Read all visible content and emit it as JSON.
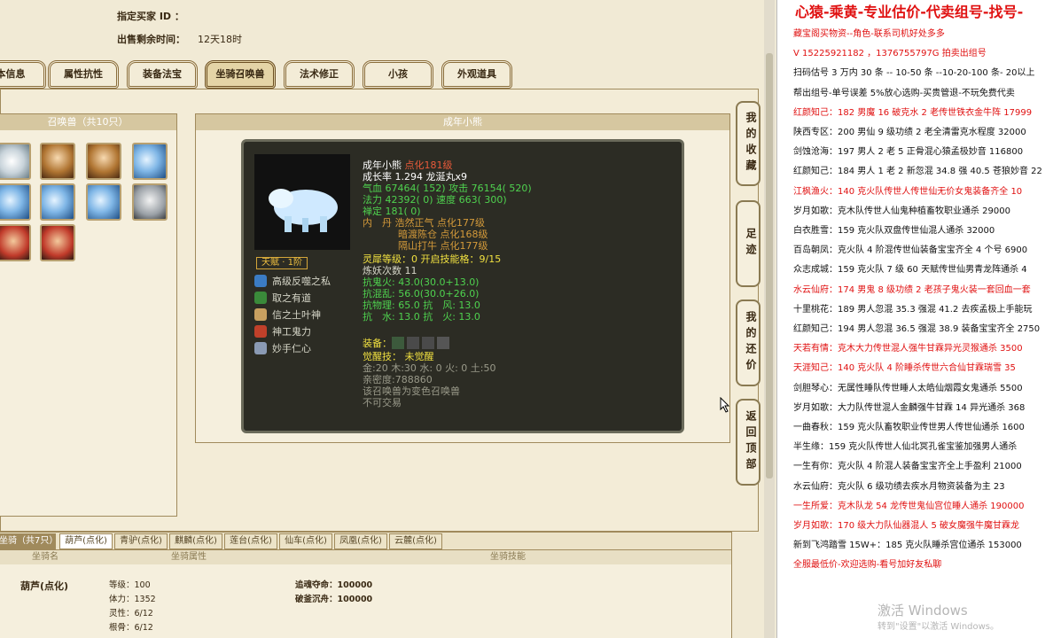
{
  "sale": {
    "buyer_label": "指定买家 ID ：",
    "remain_label": "出售剩余时间：",
    "remain_value": "12天18时"
  },
  "tabs": [
    "本信息",
    "属性抗性",
    "装备法宝",
    "坐骑召唤兽",
    "法术修正",
    "小孩",
    "外观道具"
  ],
  "pet_panel": {
    "header": "召唤兽（共10只）"
  },
  "detail_panel": {
    "header": "成年小熊"
  },
  "card": {
    "name": "成年小熊",
    "level": "点化181级",
    "growth": "成长率 1.294 龙涎丸x9",
    "hp_label": "气血",
    "hp": "67464( 152)",
    "atk_label": "攻击",
    "atk": "76154( 520)",
    "mp_label": "法力",
    "mp": "42392( 0)",
    "spd_label": "速度",
    "spd": "663( 300)",
    "zen": "禅定 181( 0)",
    "dan1": "内　丹 浩然正气 点化177级",
    "dan2": "暗渡陈仓 点化168级",
    "dan3": "隔山打牛 点化177级",
    "talent": "天赋 · 1阶",
    "lingxi": "灵犀等级：0 开启技能格：9/15",
    "yao": "炼妖次数 11",
    "res1": "抗鬼火: 43.0(30.0+13.0)",
    "res2": "抗混乱: 56.0(30.0+26.0)",
    "res3": "抗物理: 65.0 抗　风: 13.0",
    "res4": "抗　水: 13.0 抗　火: 13.0",
    "equip_label": "装备：",
    "awaken": "觉醒技： 未觉醒",
    "elements": "金:20 木:30 水: 0 火: 0 土:50",
    "intimacy": "亲密度:788860",
    "note1": "该召唤兽为变色召唤兽",
    "note2": "不可交易",
    "skills": [
      "高级反噬之私",
      "取之有道",
      "信之土叶神",
      "神工鬼力",
      "妙手仁心"
    ]
  },
  "side_buttons": [
    "我的收藏",
    "足迹",
    "我的还价",
    "返回顶部"
  ],
  "mounts": {
    "header": "坐骑（共7只）",
    "tabs": [
      "葫芦(点化)",
      "青驴(点化)",
      "麒麟(点化)",
      "莲台(点化)",
      "仙车(点化)",
      "凤凰(点化)",
      "云麓(点化)"
    ],
    "col1": "坐骑名",
    "col2": "坐骑属性",
    "col3": "坐骑技能",
    "name": "葫芦(点化)",
    "lines": [
      "等级：100",
      "体力：1352",
      "灵性：6/12",
      "根骨：6/12"
    ],
    "skills": [
      "追魂夺命：100000",
      "破釜沉舟：100000"
    ]
  },
  "right_panel": {
    "title": "心猿-乘黄-专业估价-代卖组号-找号-",
    "lines": [
      {
        "t": "藏宝阁买物资--角色-联系司机好处多多",
        "red": true
      },
      {
        "t": "V 15225921182 ，1376755797G 拍卖出组号",
        "red": true
      },
      {
        "t": "扫码估号 3 万内 30 条 -- 10-50 条 --10-20-100 条- 20以上",
        "red": false
      },
      {
        "t": "帮出组号-单号误差 5%放心选购-买贵管退-不玩免费代卖",
        "red": false
      },
      {
        "t": "红颜知己：182 男魔 16 破克水 2 老传世铁衣金牛阵 17999",
        "red": true
      },
      {
        "t": "陕西专区：200 男仙 9 级功绩 2 老全清雷克水程度 32000",
        "red": false
      },
      {
        "t": "剑蚀沧海：197 男人 2 老 5 正骨混心猿孟极妙音 116800",
        "red": false
      },
      {
        "t": "红颜知己：184 男人 1 老 2 新忽混 34.8 强 40.5 苍狼妙音 22",
        "red": false
      },
      {
        "t": "江枫渔火：140 克火队传世人传世仙无价女鬼装备齐全 10",
        "red": true
      },
      {
        "t": "岁月如歌：克木队传世人仙鬼种植畜牧职业通杀 29000",
        "red": false
      },
      {
        "t": "白衣胜雪：159 克火队双盘传世仙混人通杀 32000",
        "red": false
      },
      {
        "t": "百岛朝凤：克火队 4 阶混传世仙装备宝宝齐全 4 个号 6900",
        "red": false
      },
      {
        "t": "众志成城：159 克火队 7 级 60 天赋传世仙男青龙阵通杀 4",
        "red": false
      },
      {
        "t": "水云仙府：174 男鬼 8 级功绩 2 老孩子鬼火装一套回血一套",
        "red": true
      },
      {
        "t": "十里桃花：189 男人忽混 35.3 强混 41.2 去疾孟极上手能玩",
        "red": false
      },
      {
        "t": "红颜知己：194 男人忽混 36.5 强混 38.9 装备宝宝齐全 2750",
        "red": false
      },
      {
        "t": "天若有情：克木大力传世混人强牛甘霖异光灵猴通杀 3500",
        "red": true
      },
      {
        "t": "天涯知己：140 克火队 4 阶睡杀传世六合仙甘霖瑞雪 35",
        "red": true
      },
      {
        "t": "剑胆琴心：无属性睡队传世睡人太皓仙烟霞女鬼通杀 5500",
        "red": false
      },
      {
        "t": "岁月如歌：大力队传世混人金麟强牛甘霖 14 异光通杀 368",
        "red": false
      },
      {
        "t": "一曲春秋：159 克火队畜牧职业传世男人传世仙通杀 1600",
        "red": false
      },
      {
        "t": "半生缘：159 克火队传世人仙北冥孔雀宝鉴加强男人通杀",
        "red": false
      },
      {
        "t": "一生有你：克火队 4 阶混人装备宝宝齐全上手盈利 21000",
        "red": false
      },
      {
        "t": "水云仙府：克火队 6 级功绩去疾水月物资装备为主 23",
        "red": false
      },
      {
        "t": "一生所爱：克木队龙 54 龙传世鬼仙宫位睡人通杀 190000",
        "red": true
      },
      {
        "t": "岁月如歌：170 级大力队仙器混人 5 破女魔强牛魔甘霖龙",
        "red": true
      },
      {
        "t": "新到飞鸿踏雪 15W+：185 克火队睡杀宫位通杀 153000",
        "red": false
      },
      {
        "t": "全服最低价-欢迎选购-看号加好友私聊",
        "red": true
      }
    ]
  },
  "watermark": {
    "line1": "激活 Windows",
    "line2": "转到\"设置\"以激活 Windows。"
  }
}
